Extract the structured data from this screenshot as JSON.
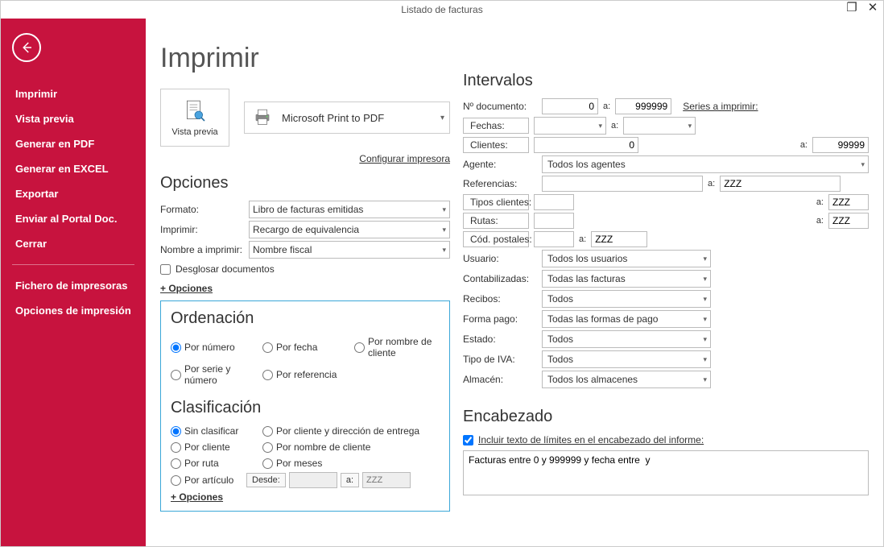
{
  "window": {
    "title": "Listado de facturas"
  },
  "sidebar": {
    "items": [
      "Imprimir",
      "Vista previa",
      "Generar en PDF",
      "Generar en EXCEL",
      "Exportar",
      "Enviar al Portal Doc.",
      "Cerrar"
    ],
    "items2": [
      "Fichero de impresoras",
      "Opciones de impresión"
    ]
  },
  "page": {
    "title": "Imprimir",
    "preview_label": "Vista previa",
    "printer_name": "Microsoft Print to PDF",
    "config_link": "Configurar impresora"
  },
  "opciones": {
    "title": "Opciones",
    "formato_lbl": "Formato:",
    "formato_val": "Libro de facturas emitidas",
    "imprimir_lbl": "Imprimir:",
    "imprimir_val": "Recargo de equivalencia",
    "nombre_lbl": "Nombre a imprimir:",
    "nombre_val": "Nombre fiscal",
    "desglosar": "Desglosar documentos",
    "mas": "+ Opciones"
  },
  "orden": {
    "title": "Ordenación",
    "r1": "Por número",
    "r2": "Por fecha",
    "r3": "Por nombre de cliente",
    "r4": "Por serie y número",
    "r5": "Por referencia"
  },
  "clasif": {
    "title": "Clasificación",
    "c1": "Sin clasificar",
    "c2": "Por cliente y dirección de entrega",
    "c3": "Por cliente",
    "c4": "Por nombre de cliente",
    "c5": "Por ruta",
    "c6": "Por meses",
    "c7": "Por artículo",
    "desde": "Desde:",
    "a": "a:",
    "zzz": "ZZZ",
    "mas": "+ Opciones"
  },
  "interv": {
    "title": "Intervalos",
    "ndoc_lbl": "Nº documento:",
    "ndoc_from": "0",
    "ndoc_to": "999999",
    "series_link": "Series a imprimir:",
    "fechas_lbl": "Fechas:",
    "clientes_lbl": "Clientes:",
    "cli_from": "0",
    "cli_to": "99999",
    "agente_lbl": "Agente:",
    "agente_val": "Todos los agentes",
    "ref_lbl": "Referencias:",
    "ref_to": "ZZZ",
    "tipos_lbl": "Tipos clientes:",
    "tipos_to": "ZZZ",
    "rutas_lbl": "Rutas:",
    "rutas_to": "ZZZ",
    "cp_lbl": "Cód. postales:",
    "cp_to": "ZZZ",
    "usuario_lbl": "Usuario:",
    "usuario_val": "Todos los usuarios",
    "contab_lbl": "Contabilizadas:",
    "contab_val": "Todas las facturas",
    "recibos_lbl": "Recibos:",
    "recibos_val": "Todos",
    "forma_lbl": "Forma pago:",
    "forma_val": "Todas las formas de pago",
    "estado_lbl": "Estado:",
    "estado_val": "Todos",
    "iva_lbl": "Tipo de IVA:",
    "iva_val": "Todos",
    "almacen_lbl": "Almacén:",
    "almacen_val": "Todos los almacenes",
    "a": "a:"
  },
  "enc": {
    "title": "Encabezado",
    "chk": "Incluir texto de límites en el encabezado del informe:",
    "text": "Facturas entre 0 y 999999 y fecha entre  y "
  }
}
